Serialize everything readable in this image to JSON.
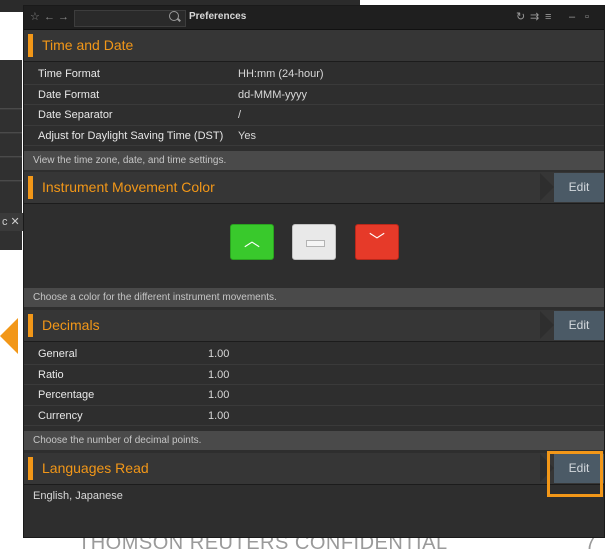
{
  "window": {
    "title": "Preferences"
  },
  "background": {
    "tab_label": "c ✕"
  },
  "sections": {
    "time_and_date": {
      "title": "Time and Date",
      "rows": [
        {
          "label": "Time Format",
          "value": "HH:mm (24-hour)"
        },
        {
          "label": "Date Format",
          "value": "dd-MMM-yyyy"
        },
        {
          "label": "Date Separator",
          "value": "/"
        },
        {
          "label": "Adjust for Daylight Saving Time (DST)",
          "value": "Yes"
        }
      ],
      "info": "View the time zone, date, and time settings."
    },
    "instrument_movement_color": {
      "title": "Instrument Movement Color",
      "edit_label": "Edit",
      "colors": {
        "up": "#39c92c",
        "unchanged": "#e9e9e9",
        "down": "#e63a29"
      },
      "info": "Choose a color for the different instrument movements."
    },
    "decimals": {
      "title": "Decimals",
      "edit_label": "Edit",
      "rows": [
        {
          "label": "General",
          "value": "1.00"
        },
        {
          "label": "Ratio",
          "value": "1.00"
        },
        {
          "label": "Percentage",
          "value": "1.00"
        },
        {
          "label": "Currency",
          "value": "1.00"
        }
      ],
      "info": "Choose the number of decimal points."
    },
    "languages_read": {
      "title": "Languages Read",
      "edit_label": "Edit",
      "value": "English, Japanese"
    }
  },
  "footer": {
    "confidential": "THOMSON REUTERS CONFIDENTIAL",
    "page": "7"
  },
  "accent_color": "#f29718"
}
